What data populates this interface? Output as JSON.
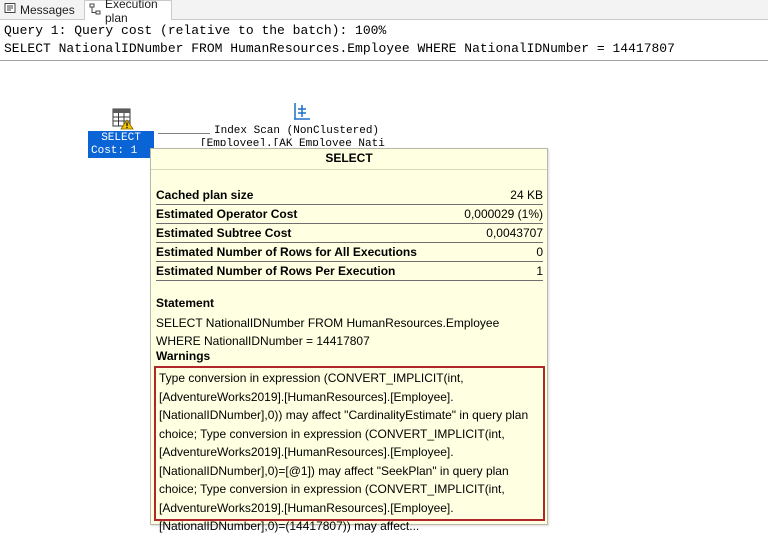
{
  "tabs": [
    {
      "label": "Messages",
      "icon": "messages-icon"
    },
    {
      "label": "Execution plan",
      "icon": "execution-plan-icon",
      "active": true
    }
  ],
  "query": {
    "cost_line": "Query 1: Query cost (relative to the batch): 100%",
    "sql_line": "SELECT NationalIDNumber FROM HumanResources.Employee WHERE NationalIDNumber = 14417807"
  },
  "plan": {
    "select_node": {
      "label": "SELECT",
      "cost": "Cost: 1",
      "icon": "select-warning-icon"
    },
    "scan_node": {
      "title": "Index Scan (NonClustered)",
      "subtitle": "[Employee].[AK_Employee_Nati",
      "icon": "index-scan-icon"
    }
  },
  "tooltip": {
    "title": "SELECT",
    "properties": [
      {
        "name": "Cached plan size",
        "value": "24 KB"
      },
      {
        "name": "Estimated Operator Cost",
        "value": "0,000029 (1%)"
      },
      {
        "name": "Estimated Subtree Cost",
        "value": "0,0043707"
      },
      {
        "name": "Estimated Number of Rows for All Executions",
        "value": "0"
      },
      {
        "name": "Estimated Number of Rows Per Execution",
        "value": "1"
      }
    ],
    "statement_label": "Statement",
    "statement_text": "SELECT NationalIDNumber FROM HumanResources.Employee WHERE NationalIDNumber = 14417807",
    "warnings_label": "Warnings",
    "warnings_text": "Type conversion in expression (CONVERT_IMPLICIT(int,[AdventureWorks2019].[HumanResources].[Employee].[NationalIDNumber],0)) may affect \"CardinalityEstimate\" in query plan choice; Type conversion in expression (CONVERT_IMPLICIT(int,[AdventureWorks2019].[HumanResources].[Employee].[NationalIDNumber],0)=[@1]) may affect \"SeekPlan\" in query plan choice; Type conversion in expression (CONVERT_IMPLICIT(int,[AdventureWorks2019].[HumanResources].[Employee].[NationalIDNumber],0)=(14417807)) may affect...",
    "warning_border_color": "#b0262a"
  }
}
